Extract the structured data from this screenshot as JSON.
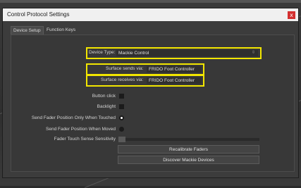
{
  "window": {
    "title": "Control Protocol Settings",
    "close_glyph": "x"
  },
  "tabs": [
    {
      "label": "Device Setup"
    },
    {
      "label": "Function Keys"
    }
  ],
  "device_type": {
    "label": "Device Type:",
    "value": "Mackie Control",
    "icon": "dropdown-chevron-icon"
  },
  "surface_sends": {
    "label": "Surface sends via:",
    "value": "FRIDO Foot Controller"
  },
  "surface_receives": {
    "label": "Surface receives via:",
    "value": "FRIDO Foot Controller"
  },
  "options": {
    "button_click": {
      "label": "Button click",
      "checked": false
    },
    "backlight": {
      "label": "Backlight",
      "checked": false
    },
    "fader_touched": {
      "label": "Send Fader Position Only When Touched",
      "selected": true
    },
    "fader_moved": {
      "label": "Send Fader Position When Moved",
      "selected": false
    },
    "touch_sensitivity": {
      "label": "Fader Touch Sense Sensitivity",
      "value": 0
    }
  },
  "buttons": {
    "recalibrate": "Recalibrate Faders",
    "discover": "Discover Mackie Devices"
  },
  "colors": {
    "highlight": "#f2e600",
    "close": "#d32f2f",
    "dialog_bg": "#3c3c3c"
  }
}
